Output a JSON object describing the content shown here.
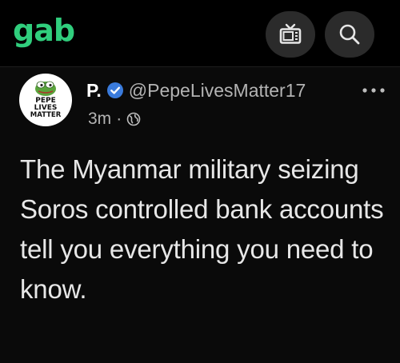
{
  "app": {
    "logo_text": "gab",
    "brand_color": "#30ce7d"
  },
  "toolbar": {
    "tv_icon": "tv-icon",
    "search_icon": "search-icon"
  },
  "post": {
    "display_name": "P.",
    "verified": true,
    "handle": "@PepeLivesMatter17",
    "timestamp": "3m",
    "separator": "·",
    "visibility_icon": "globe-icon",
    "avatar_text": [
      "PEPE",
      "LIVES",
      "MATTER"
    ],
    "text": "The Myanmar military seizing Soros controlled bank accounts tell you everything you need to know."
  }
}
